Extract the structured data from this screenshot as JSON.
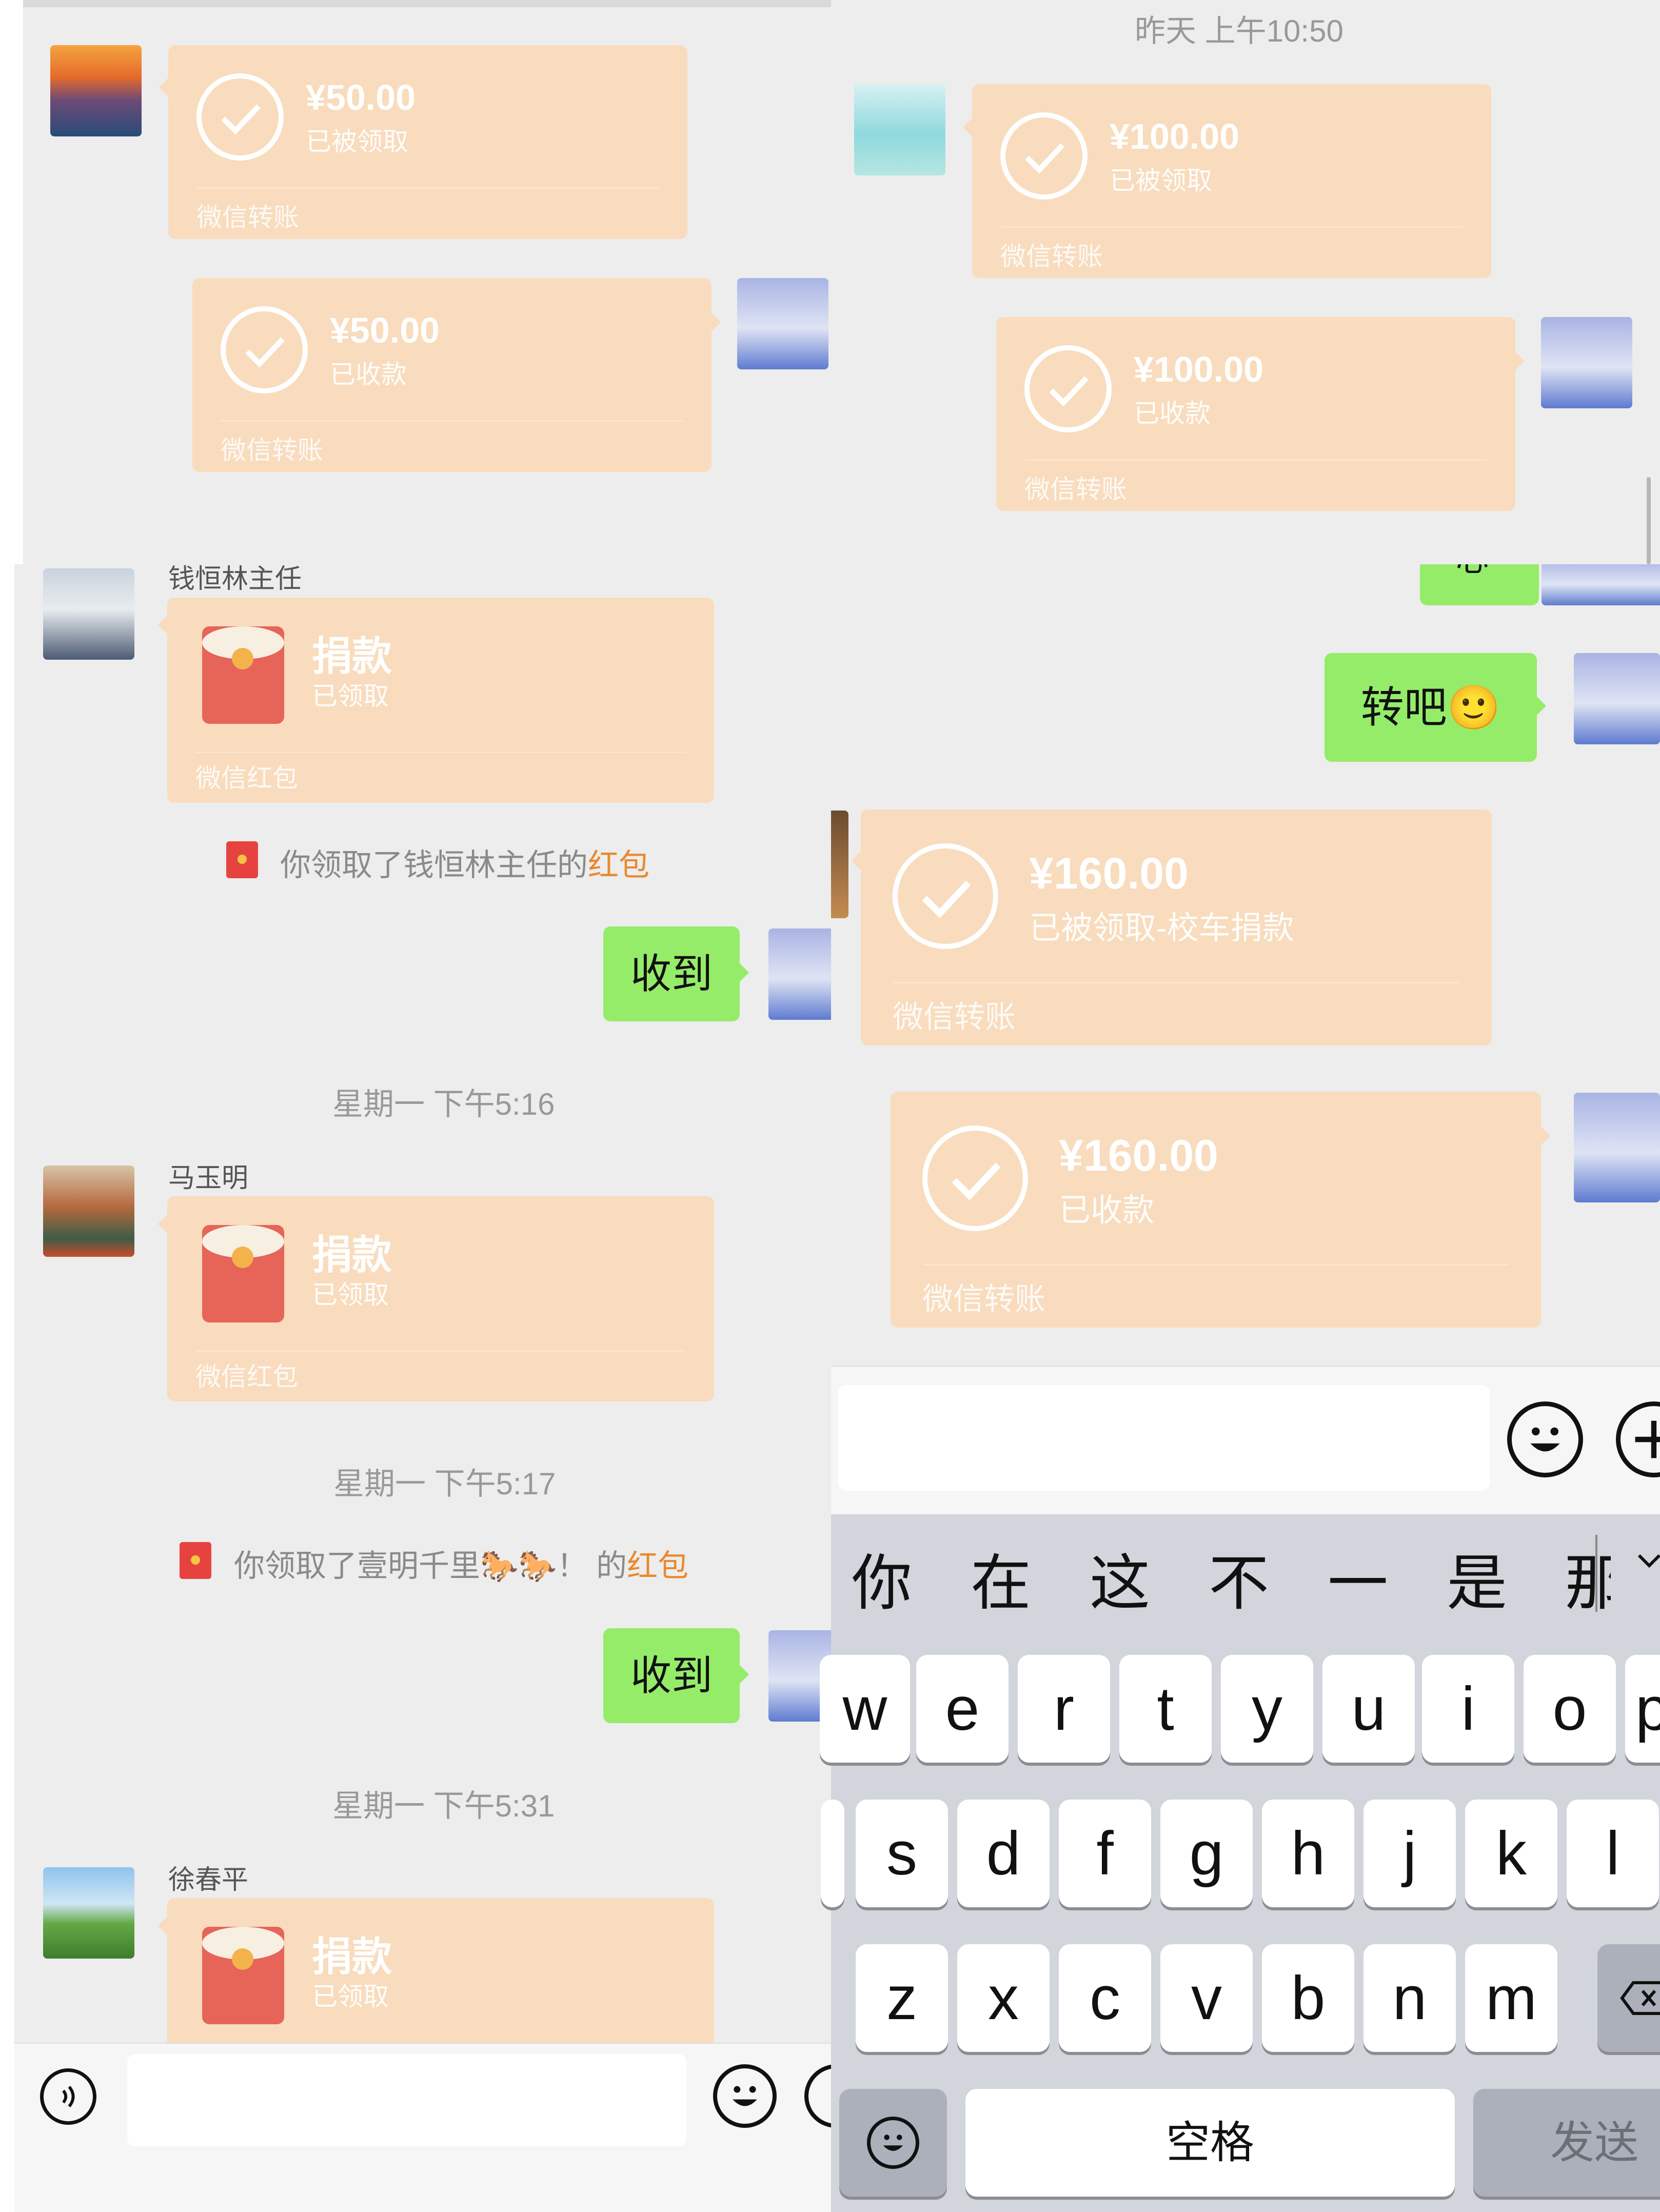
{
  "left_top": {
    "transfer_in": {
      "amount": "¥50.00",
      "status": "已被领取",
      "footer": "微信转账"
    },
    "transfer_out": {
      "amount": "¥50.00",
      "status": "已收款",
      "footer": "微信转账"
    }
  },
  "right_top": {
    "timestamp": "昨天 上午10:50",
    "transfer_in": {
      "amount": "¥100.00",
      "status": "已被领取",
      "footer": "微信转账"
    },
    "transfer_out": {
      "amount": "¥100.00",
      "status": "已收款",
      "footer": "微信转账"
    }
  },
  "left_chat": {
    "msg1": {
      "sender": "钱恒林主任",
      "title": "捐款",
      "status": "已领取",
      "footer": "微信红包"
    },
    "sys1": {
      "prefix": "你领取了钱恒林主任的",
      "link": "红包"
    },
    "reply1": "收到",
    "ts1": "星期一 下午5:16",
    "msg2": {
      "sender": "马玉明",
      "title": "捐款",
      "status": "已领取",
      "footer": "微信红包"
    },
    "ts2": "星期一 下午5:17",
    "sys2": {
      "prefix": "你领取了壹明千里🐎🐎！ 的",
      "link": "红包"
    },
    "reply2": "收到",
    "ts3": "星期一 下午5:31",
    "msg3": {
      "sender": "徐春平",
      "title": "捐款",
      "status": "已领取"
    }
  },
  "right_chat": {
    "top_partial": "心",
    "reply": "转吧🙂",
    "transfer_in": {
      "amount": "¥160.00",
      "status": "已被领取-校车捐款",
      "footer": "微信转账"
    },
    "transfer_out": {
      "amount": "¥160.00",
      "status": "已收款",
      "footer": "微信转账"
    }
  },
  "keyboard": {
    "candidates": [
      "你",
      "在",
      "这",
      "不",
      "一",
      "是",
      "那"
    ],
    "row1": [
      "w",
      "e",
      "r",
      "t",
      "y",
      "u",
      "i",
      "o",
      "p"
    ],
    "row2": [
      "s",
      "d",
      "f",
      "g",
      "h",
      "j",
      "k",
      "l"
    ],
    "row3": [
      "z",
      "x",
      "c",
      "v",
      "b",
      "n",
      "m"
    ],
    "space": "空格",
    "send": "发送"
  },
  "icons": [
    "check-icon",
    "red-packet-icon",
    "voice-icon",
    "emoji-icon",
    "plus-icon",
    "delete-icon",
    "chevron-down-icon"
  ]
}
